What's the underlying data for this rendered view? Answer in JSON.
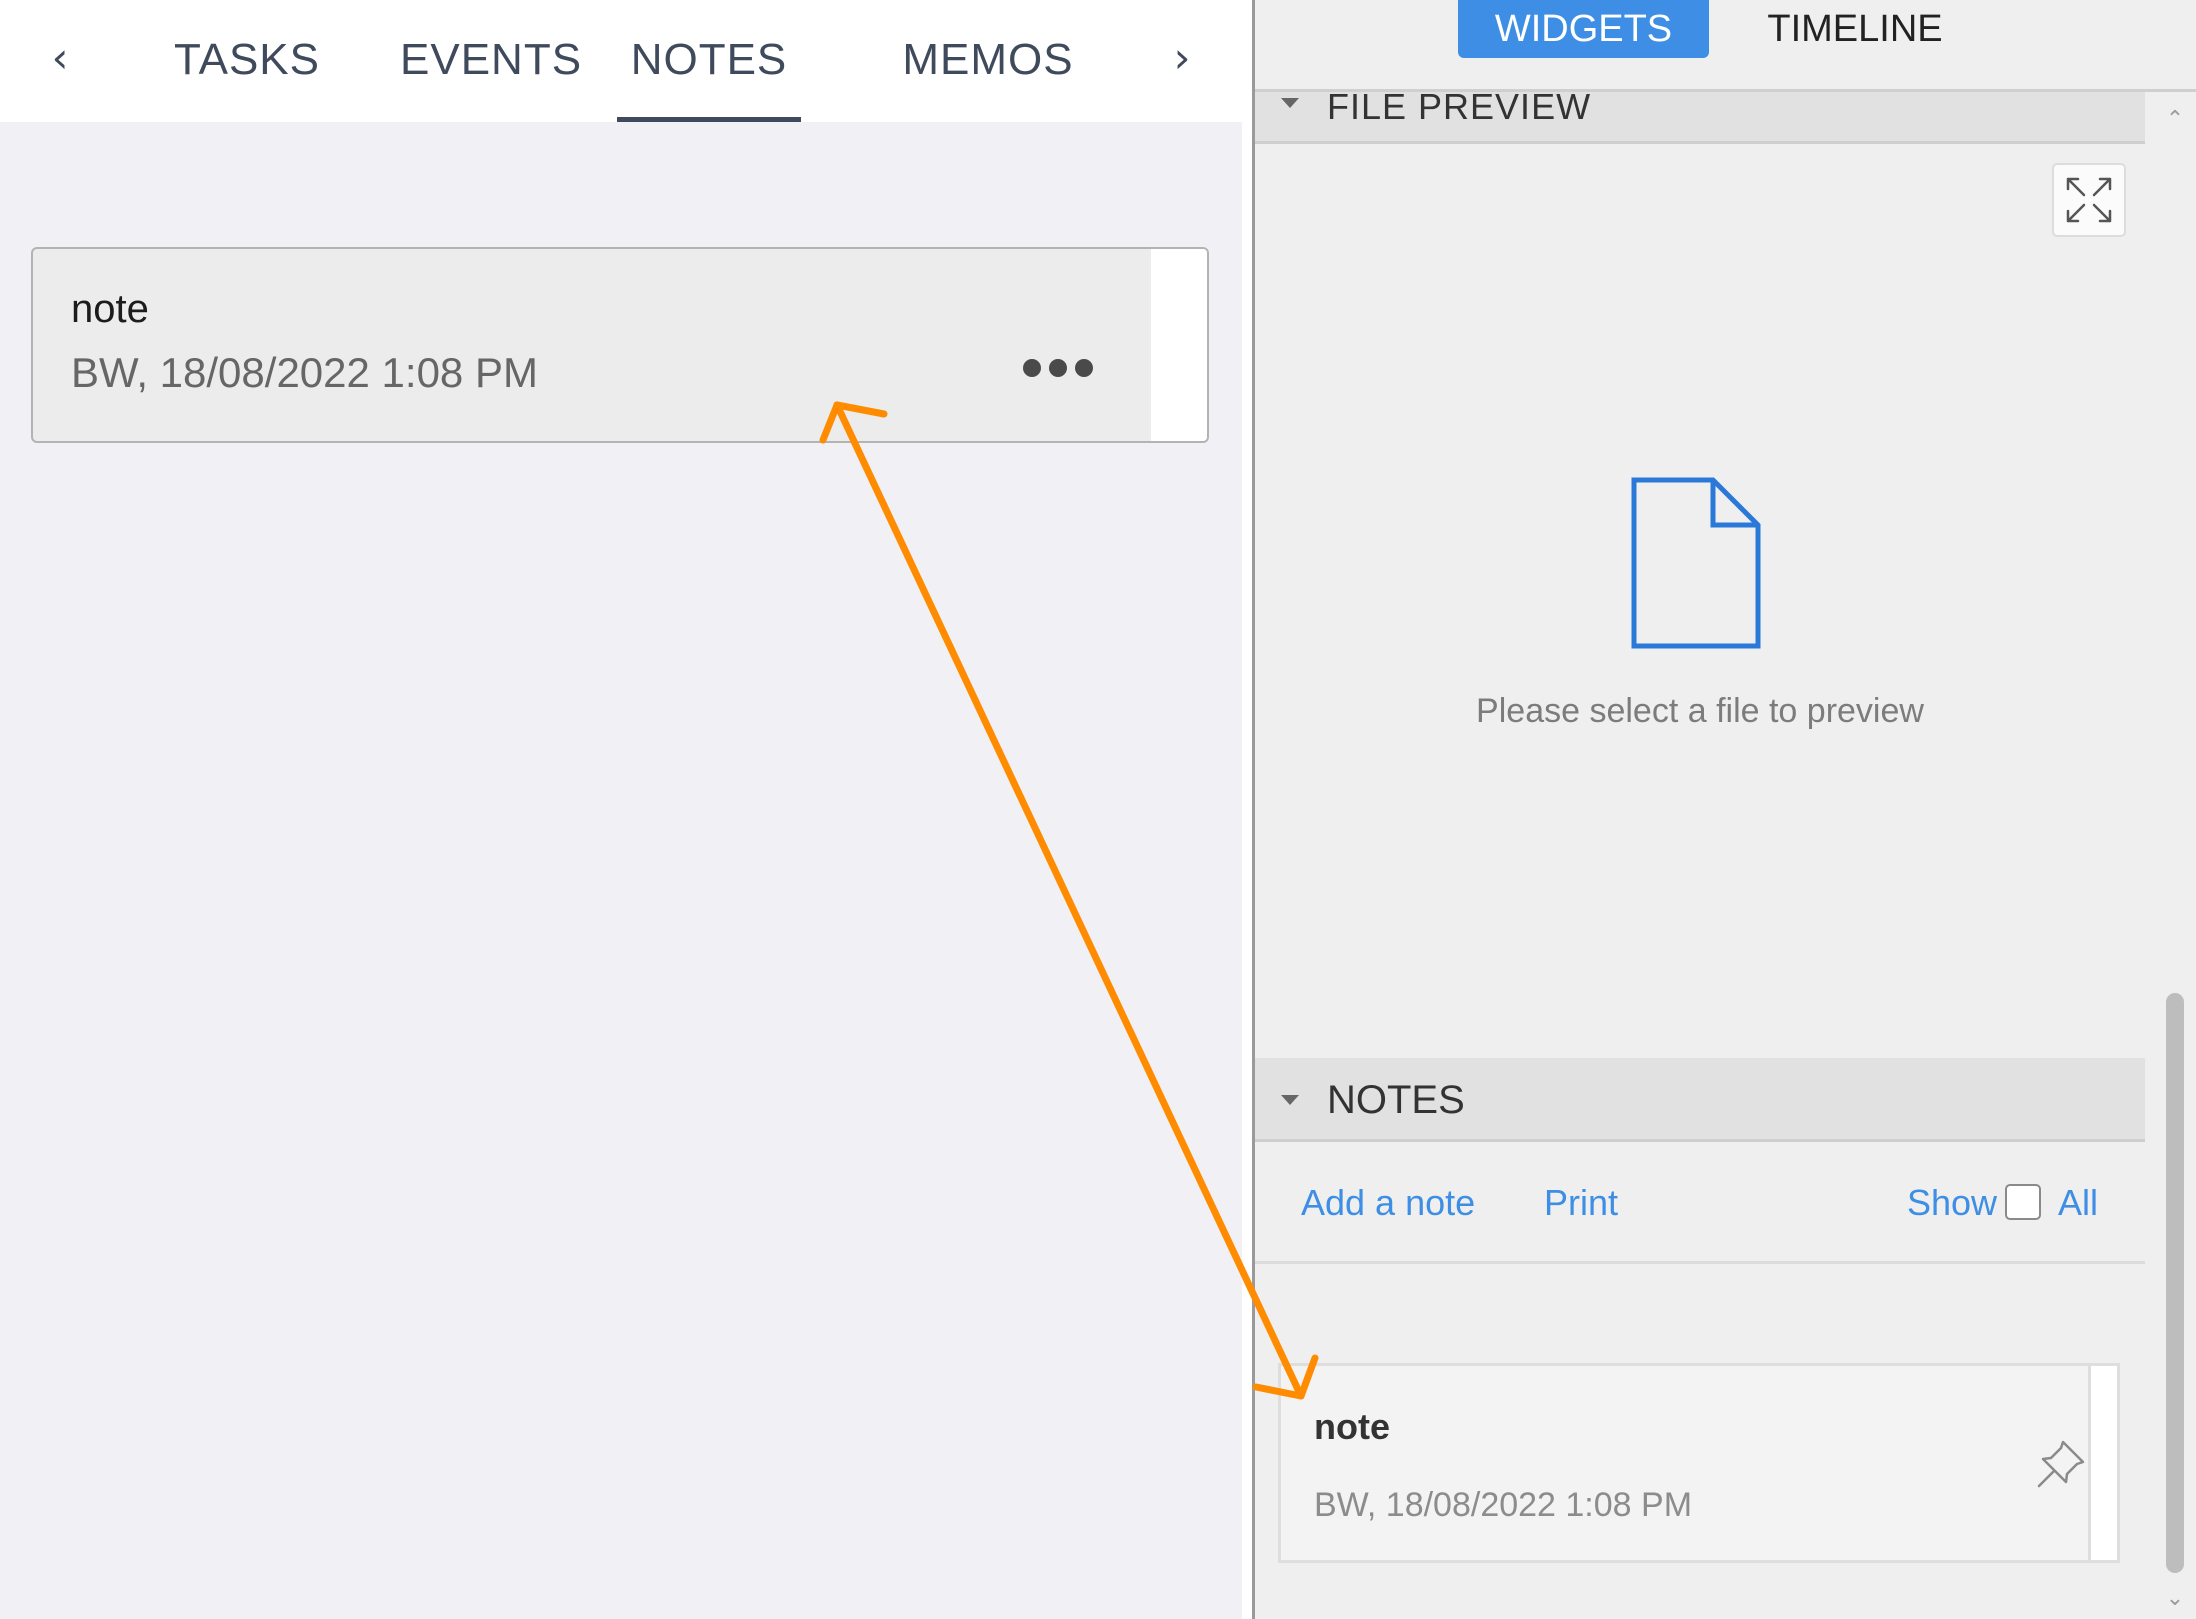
{
  "left_tabs": {
    "prev_icon": "chevron-left-icon",
    "next_icon": "chevron-right-icon",
    "items": [
      {
        "label": "TASKS"
      },
      {
        "label": "EVENTS"
      },
      {
        "label": "NOTES",
        "active": true
      },
      {
        "label": "MEMOS"
      }
    ]
  },
  "note_card": {
    "title": "note",
    "meta": "BW, 18/08/2022 1:08 PM",
    "menu_icon": "more-horizontal-icon"
  },
  "right_panel": {
    "tabs": {
      "widgets": "WIDGETS",
      "timeline": "TIMELINE",
      "active": "WIDGETS"
    },
    "file_preview": {
      "header": "FILE PREVIEW",
      "empty_text": "Please select a file to preview",
      "icon": "file-icon",
      "expand_icon": "fullscreen-icon"
    },
    "notes": {
      "header": "NOTES",
      "add_label": "Add a note",
      "print_label": "Print",
      "show_label": "Show",
      "all_label": "All",
      "show_all_checked": false,
      "items": [
        {
          "title": "note",
          "meta": "BW, 18/08/2022 1:08 PM",
          "icon": "pin-icon"
        }
      ]
    }
  },
  "colors": {
    "accent": "#3d8ee4",
    "annotation": "#ff8c00",
    "tab_text": "#3f4a5c"
  }
}
